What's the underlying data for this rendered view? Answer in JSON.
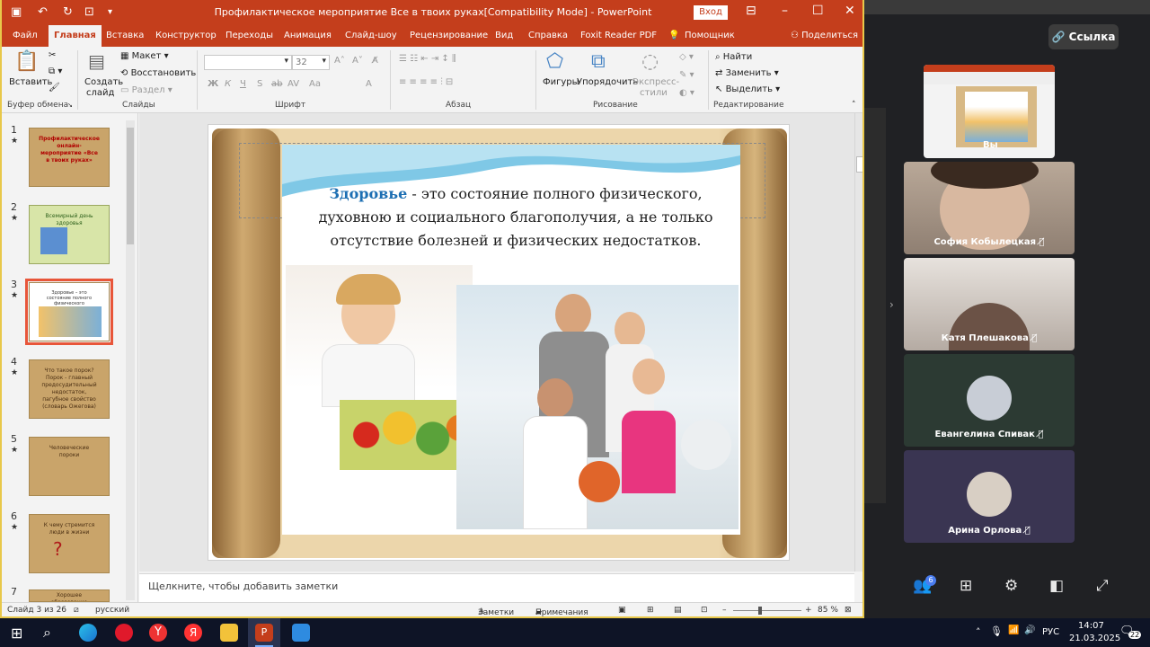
{
  "window": {
    "title": "Профилактическое мероприятие Все в твоих руках[Compatibility Mode]  -  PowerPoint",
    "signin": "Вход"
  },
  "tabs": [
    "Файл",
    "Главная",
    "Вставка",
    "Конструктор",
    "Переходы",
    "Анимация",
    "Слайд-шоу",
    "Рецензирование",
    "Вид",
    "Справка",
    "Foxit Reader PDF",
    "Помощник",
    "Поделиться"
  ],
  "ribbon": {
    "paste": "Вставить",
    "clipboard_group": "Буфер обмена",
    "new_slide": "Создать",
    "new_slide2": "слайд",
    "layout": "Макет",
    "reset": "Восстановить",
    "section": "Раздел",
    "slides_group": "Слайды",
    "font_size": "32",
    "font_group": "Шрифт",
    "paragraph_group": "Абзац",
    "shapes": "Фигуры",
    "arrange": "Упорядочить",
    "quick_styles": "Экспресс-",
    "quick_styles2": "стили",
    "drawing_group": "Рисование",
    "find": "Найти",
    "replace": "Заменить",
    "select": "Выделить",
    "editing_group": "Редактирование",
    "font_buttons": [
      "Ж",
      "К",
      "Ч",
      "S",
      "ab",
      "AV",
      "Aa",
      "A"
    ]
  },
  "thumbnails": [
    {
      "num": "1",
      "text": "Профилактическое онлайн-мероприятие «Все в твоих руках»"
    },
    {
      "num": "2",
      "text": "Всемирный день здоровья"
    },
    {
      "num": "3",
      "text": "Здоровье – это состояние полного физического благополучия"
    },
    {
      "num": "4",
      "text": "Что такое порок? Порок - главный предосудительный недостаток, пагубное свойство (словарь Ожегова)"
    },
    {
      "num": "5",
      "text": "Человеческие пороки"
    },
    {
      "num": "6",
      "text": "К чему стремится люди в жизни"
    },
    {
      "num": "7",
      "text": "Хорошее образование"
    }
  ],
  "slide": {
    "keyword": "Здоровье",
    "text": " - это состояние полного физического, духовною и социального благополучия, а не только отсутствие болезней и физических недостатков."
  },
  "notes_placeholder": "Щелкните, чтобы добавить заметки",
  "status": {
    "slide_counter": "Слайд 3 из 26",
    "language": "русский",
    "notes": "Заметки",
    "comments": "Примечания",
    "zoom": "85 %"
  },
  "meeting": {
    "link_button": "Ссылка",
    "self_label": "Вы",
    "participants": [
      {
        "name": "София Кобылецкая",
        "muted": true
      },
      {
        "name": "Катя Плешакова",
        "muted": true
      },
      {
        "name": "Евангелина Спивак",
        "muted": true
      },
      {
        "name": "Арина Орлова",
        "muted": true
      }
    ],
    "participant_count": "6"
  },
  "taskbar": {
    "lang": "РУС",
    "time": "14:07",
    "date": "21.03.2025",
    "notifications": "22"
  }
}
